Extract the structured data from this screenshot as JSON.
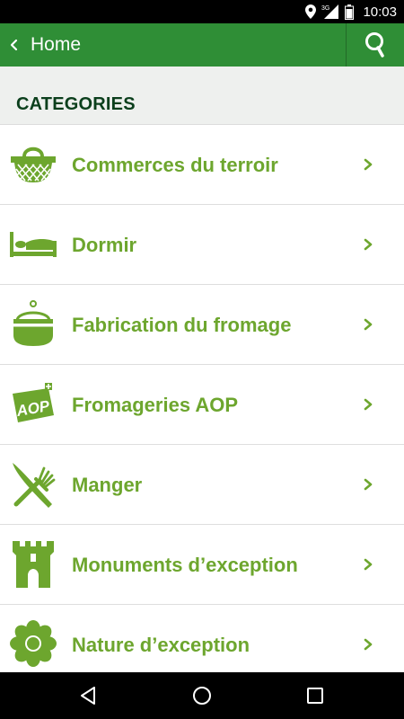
{
  "status_bar": {
    "time": "10:03",
    "network": "3G",
    "icons": [
      "location-icon",
      "signal-icon",
      "battery-icon"
    ]
  },
  "app_bar": {
    "title": "Home",
    "back_icon": "chevron-left-icon",
    "search_icon": "search-icon",
    "color": "#2f8e36"
  },
  "section": {
    "title": "CATEGORIES"
  },
  "categories": [
    {
      "label": "Commerces du terroir",
      "icon": "basket-icon"
    },
    {
      "label": "Dormir",
      "icon": "bed-icon"
    },
    {
      "label": "Fabrication du fromage",
      "icon": "cauldron-icon"
    },
    {
      "label": "Fromageries AOP",
      "icon": "aop-icon",
      "icon_text": "AOP"
    },
    {
      "label": "Manger",
      "icon": "fork-knife-icon"
    },
    {
      "label": "Monuments d’exception",
      "icon": "castle-tower-icon"
    },
    {
      "label": "Nature d’exception",
      "icon": "flower-icon"
    }
  ],
  "nav_bar": {
    "buttons": [
      "back-triangle-icon",
      "home-circle-icon",
      "recents-square-icon"
    ]
  },
  "colors": {
    "accent": "#6da62e",
    "header_bg": "#eef0ee",
    "title_text": "#0b3f1c"
  }
}
